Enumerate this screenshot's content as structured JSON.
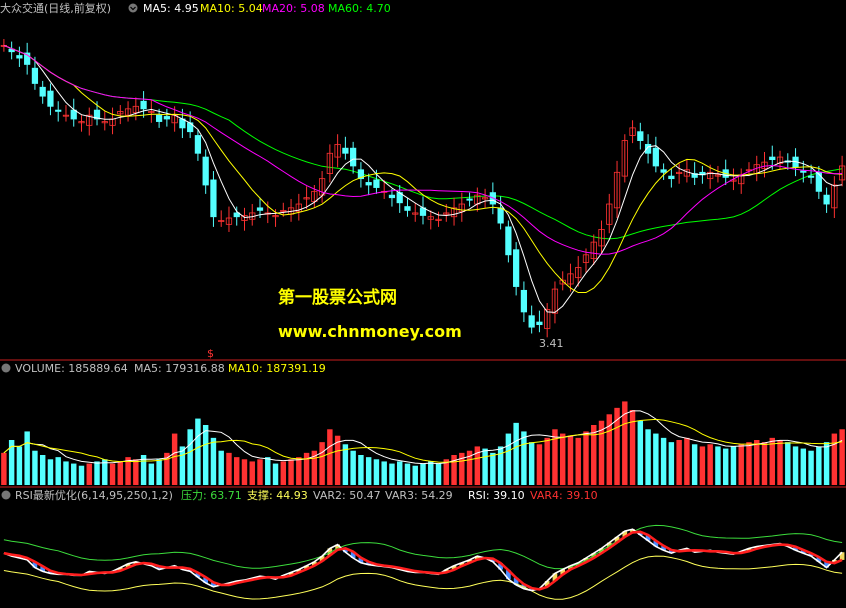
{
  "colors": {
    "background": "#000000",
    "up": "#ff3232",
    "down": "#54ffff",
    "ma5": "#ffffff",
    "ma10": "#ffff00",
    "ma20": "#ff00ff",
    "ma60": "#00ff00",
    "separator": "#c81e1e",
    "label": "#c0c0c0",
    "watermark": "#ffff00",
    "rsi_support_line": "#ffff5a",
    "rsi_resist_line": "#3cdc3c",
    "rsi_line": "#ff1e1e",
    "rsi_white": "#ffffff",
    "var_bars": "#4a8cff"
  },
  "header": {
    "stock_name": "大众交通(日线,前复权)",
    "ma5": "MA5: 4.95",
    "ma10": "MA10: 5.04",
    "ma20": "MA20: 5.08",
    "ma60": "MA60: 4.70"
  },
  "volume_header": {
    "volume": "VOLUME: 185889.64",
    "ma5": "MA5: 179316.88",
    "ma10": "MA10: 187391.19"
  },
  "rsi_header": {
    "title": "RSI最新优化(6,14,95,250,1,2)",
    "pressure": "压力: 63.71",
    "support": "支撑: 44.93",
    "var2": "VAR2: 50.47",
    "var3": "VAR3: 54.29",
    "rsi": "RSI: 39.10",
    "var4": "VAR4: 39.10"
  },
  "watermark": {
    "line1": "第一股票公式网",
    "line2": "www.chnmoney.com"
  },
  "signal_marker": "$",
  "chart_data": {
    "type": "candlestick",
    "low_annotation": "3.41",
    "price_range": [
      3.3,
      5.9
    ],
    "close": [
      5.7,
      5.65,
      5.6,
      5.55,
      5.4,
      5.3,
      5.22,
      5.18,
      5.15,
      5.12,
      5.1,
      5.15,
      5.12,
      5.1,
      5.12,
      5.18,
      5.2,
      5.22,
      5.2,
      5.18,
      5.1,
      5.12,
      5.15,
      5.05,
      5.02,
      4.85,
      4.6,
      4.35,
      4.32,
      4.34,
      4.35,
      4.36,
      4.38,
      4.4,
      4.38,
      4.36,
      4.4,
      4.42,
      4.45,
      4.5,
      4.55,
      4.65,
      4.85,
      4.92,
      4.85,
      4.75,
      4.65,
      4.6,
      4.58,
      4.55,
      4.5,
      4.46,
      4.4,
      4.38,
      4.36,
      4.35,
      4.33,
      4.38,
      4.42,
      4.45,
      4.48,
      4.52,
      4.5,
      4.45,
      4.3,
      4.05,
      3.8,
      3.6,
      3.48,
      3.5,
      3.62,
      3.78,
      3.85,
      3.9,
      3.95,
      4.05,
      4.15,
      4.25,
      4.45,
      4.7,
      4.95,
      5.05,
      4.95,
      4.85,
      4.75,
      4.7,
      4.65,
      4.7,
      4.72,
      4.66,
      4.68,
      4.7,
      4.68,
      4.66,
      4.64,
      4.68,
      4.72,
      4.76,
      4.78,
      4.8,
      4.82,
      4.78,
      4.74,
      4.7,
      4.66,
      4.55,
      4.45,
      4.6,
      4.75
    ],
    "volume": [
      1.5,
      2.1,
      1.8,
      2.5,
      1.6,
      1.4,
      1.2,
      1.3,
      1.1,
      1.0,
      0.9,
      1.0,
      1.1,
      1.2,
      1.0,
      1.1,
      1.3,
      1.2,
      1.4,
      1.0,
      1.2,
      1.5,
      2.4,
      1.8,
      2.6,
      3.1,
      2.8,
      2.2,
      1.6,
      1.5,
      1.3,
      1.2,
      1.1,
      1.2,
      1.3,
      1.0,
      1.1,
      1.2,
      1.3,
      1.5,
      1.6,
      2.0,
      2.6,
      2.3,
      1.9,
      1.6,
      1.4,
      1.3,
      1.2,
      1.1,
      1.0,
      1.1,
      1.0,
      0.9,
      1.0,
      1.1,
      1.0,
      1.2,
      1.4,
      1.5,
      1.6,
      1.8,
      1.7,
      1.5,
      1.8,
      2.4,
      2.9,
      2.5,
      2.0,
      1.9,
      2.2,
      2.6,
      2.4,
      2.3,
      2.2,
      2.5,
      2.8,
      3.0,
      3.3,
      3.6,
      3.9,
      3.5,
      3.0,
      2.6,
      2.4,
      2.2,
      2.0,
      2.1,
      2.2,
      1.9,
      1.8,
      1.9,
      1.8,
      1.7,
      1.8,
      1.9,
      2.0,
      2.1,
      2.0,
      2.2,
      2.1,
      2.0,
      1.8,
      1.7,
      1.6,
      1.8,
      2.0,
      2.4,
      2.6
    ],
    "rsi": [
      55,
      52,
      50,
      48,
      40,
      36,
      34,
      33,
      33,
      32,
      32,
      36,
      35,
      34,
      36,
      40,
      44,
      46,
      44,
      42,
      38,
      40,
      42,
      38,
      36,
      30,
      24,
      20,
      22,
      24,
      26,
      27,
      29,
      31,
      30,
      28,
      32,
      35,
      38,
      42,
      46,
      52,
      60,
      64,
      56,
      50,
      45,
      43,
      42,
      41,
      40,
      38,
      36,
      35,
      35,
      34,
      33,
      38,
      42,
      45,
      48,
      52,
      50,
      46,
      38,
      28,
      22,
      18,
      16,
      18,
      26,
      34,
      38,
      42,
      45,
      50,
      55,
      60,
      66,
      72,
      78,
      80,
      74,
      68,
      62,
      58,
      55,
      58,
      60,
      56,
      57,
      58,
      56,
      55,
      54,
      57,
      60,
      62,
      63,
      64,
      65,
      62,
      58,
      55,
      52,
      46,
      40,
      48,
      56
    ]
  }
}
